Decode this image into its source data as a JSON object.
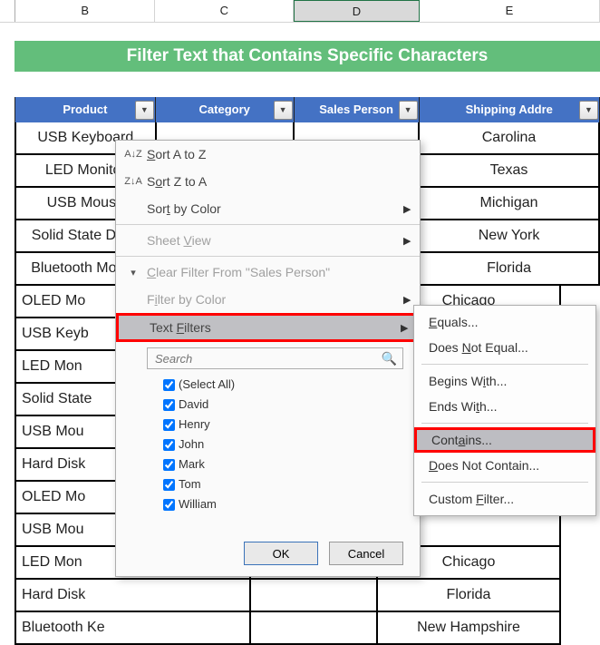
{
  "columns": {
    "B": "B",
    "C": "C",
    "D": "D",
    "E": "E"
  },
  "title": "Filter Text that Contains Specific Characters",
  "headers": {
    "product": "Product",
    "category": "Category",
    "sales": "Sales Person",
    "ship": "Shipping Addre"
  },
  "rows": [
    {
      "product": "USB Keyboard",
      "ship": "Carolina"
    },
    {
      "product": "LED Monitor",
      "ship": "Texas"
    },
    {
      "product": "USB Mouse",
      "ship": "Michigan"
    },
    {
      "product": "Solid State Drive",
      "ship": "New York"
    },
    {
      "product": "Bluetooth Mouse",
      "ship": "Florida"
    },
    {
      "product": "OLED Monitor",
      "ship": "Chicago"
    },
    {
      "product": "USB Keyboard",
      "ship": ""
    },
    {
      "product": "LED Monitor",
      "ship": ""
    },
    {
      "product": "Solid State Drive",
      "ship": ""
    },
    {
      "product": "USB Mouse",
      "ship": ""
    },
    {
      "product": "Hard Disk Drive",
      "ship": ""
    },
    {
      "product": "OLED Monitor",
      "ship": ""
    },
    {
      "product": "USB Mouse",
      "ship": ""
    },
    {
      "product": "LED Monitor",
      "ship": "Chicago"
    },
    {
      "product": "Hard Disk Drive",
      "ship": "Florida"
    },
    {
      "product": "Bluetooth Keyboard",
      "ship": "New Hampshire"
    }
  ],
  "menu": {
    "sortAZ": "Sort A to Z",
    "sortZA": "Sort Z to A",
    "sortColor": "Sort by Color",
    "sheetView": "Sheet View",
    "clear": "Clear Filter From \"Sales Person\"",
    "filterColor": "Filter by Color",
    "textFilters": "Text Filters",
    "searchPlaceholder": "Search",
    "checks": [
      "(Select All)",
      "David",
      "Henry",
      "John",
      "Mark",
      "Tom",
      "William"
    ],
    "ok": "OK",
    "cancel": "Cancel"
  },
  "sub": {
    "equals": "Equals...",
    "notequal": "Does Not Equal...",
    "begins": "Begins With...",
    "ends": "Ends With...",
    "contains": "Contains...",
    "notcontain": "Does Not Contain...",
    "custom": "Custom Filter..."
  }
}
